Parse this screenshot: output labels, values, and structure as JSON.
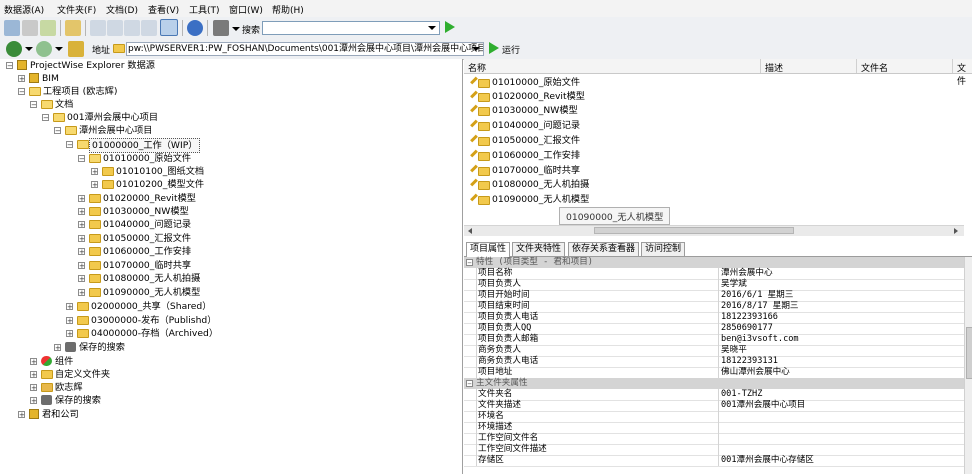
{
  "menu": [
    "数据源(A)",
    "文件夹(F)",
    "文档(D)",
    "查看(V)",
    "工具(T)",
    "窗口(W)",
    "帮助(H)"
  ],
  "toolbar": {
    "search_label": "搜索"
  },
  "address": {
    "label": "地址",
    "value": "pw:\\\\PWSERVER1:PW_FOSHAN\\Documents\\001潭州会展中心项目\\潭州会展中心项目\\0",
    "go_label": "运行"
  },
  "tree": [
    {
      "label": "ProjectWise Explorer 数据源"
    },
    {
      "label": "BIM"
    },
    {
      "label": "工程项目 (欧志辉)"
    },
    {
      "label": "文档"
    },
    {
      "label": "001潭州会展中心项目"
    },
    {
      "label": "潭州会展中心项目"
    },
    {
      "label": "01000000_工作（WIP）"
    },
    {
      "label": "01010000_原始文件"
    },
    {
      "label": "01010100_图纸文档"
    },
    {
      "label": "01010200_模型文件"
    },
    {
      "label": "01020000_Revit模型"
    },
    {
      "label": "01030000_NW模型"
    },
    {
      "label": "01040000_问题记录"
    },
    {
      "label": "01050000_汇报文件"
    },
    {
      "label": "01060000_工作安排"
    },
    {
      "label": "01070000_临时共享"
    },
    {
      "label": "01080000_无人机拍摄"
    },
    {
      "label": "01090000_无人机模型"
    },
    {
      "label": "02000000_共享（Shared）"
    },
    {
      "label": "03000000-发布（Publishd）"
    },
    {
      "label": "04000000-存档（Archived）"
    },
    {
      "label": "保存的搜索"
    },
    {
      "label": "组件"
    },
    {
      "label": "自定义文件夹"
    },
    {
      "label": "欧志辉"
    },
    {
      "label": "保存的搜索"
    },
    {
      "label": "君和公司"
    }
  ],
  "list": {
    "columns": [
      "名称",
      "描述",
      "文件名",
      "文件"
    ],
    "items": [
      "01010000_原始文件",
      "01020000_Revit模型",
      "01030000_NW模型",
      "01040000_问题记录",
      "01050000_汇报文件",
      "01060000_工作安排",
      "01070000_临时共享",
      "01080000_无人机拍摄",
      "01090000_无人机模型"
    ],
    "tooltip": "01090000_无人机模型"
  },
  "tabs": [
    "项目属性",
    "文件夹特性",
    "依存关系查看器",
    "访问控制"
  ],
  "props": {
    "cat1": "特性 (项目类型 - 君和项目)",
    "rows1": [
      {
        "k": "项目名称",
        "v": "潭州会展中心"
      },
      {
        "k": "项目负责人",
        "v": "吴学斌"
      },
      {
        "k": "项目开始时间",
        "v": "2016/6/1 星期三"
      },
      {
        "k": "项目结束时间",
        "v": "2016/8/17 星期三"
      },
      {
        "k": "项目负责人电话",
        "v": "18122393166"
      },
      {
        "k": "项目负责人QQ",
        "v": "2850690177"
      },
      {
        "k": "项目负责人邮箱",
        "v": "ben@i3vsoft.com"
      },
      {
        "k": "商务负责人",
        "v": "吴晓平"
      },
      {
        "k": "商务负责人电话",
        "v": "18122393131"
      },
      {
        "k": "项目地址",
        "v": "佛山潭州会展中心"
      }
    ],
    "cat2": "主文件夹属性",
    "rows2": [
      {
        "k": "文件夹名",
        "v": "001-TZHZ"
      },
      {
        "k": "文件夹描述",
        "v": "001潭州会展中心项目"
      },
      {
        "k": "环境名",
        "v": ""
      },
      {
        "k": "环境描述",
        "v": ""
      },
      {
        "k": "工作空间文件名",
        "v": ""
      },
      {
        "k": "工作空间文件描述",
        "v": ""
      },
      {
        "k": "存储区",
        "v": "001潭州会展中心存储区"
      }
    ]
  }
}
